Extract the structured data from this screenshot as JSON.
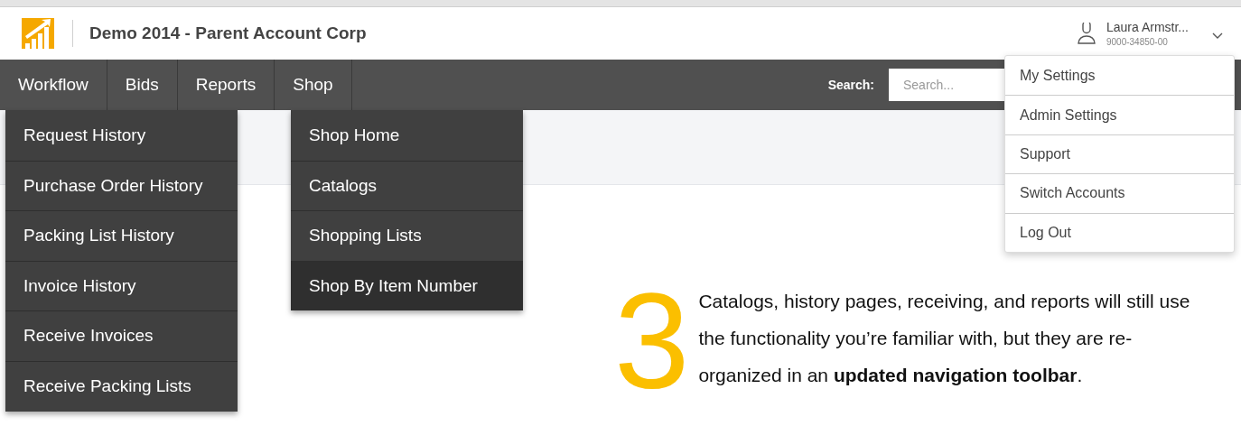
{
  "header": {
    "title": "Demo 2014 - Parent Account Corp",
    "user": {
      "name": "Laura Armstr...",
      "account": "9000-34850-00"
    }
  },
  "nav": {
    "items": [
      {
        "label": "Workflow"
      },
      {
        "label": "Bids"
      },
      {
        "label": "Reports"
      },
      {
        "label": "Shop"
      }
    ],
    "search": {
      "label": "Search:",
      "placeholder": "Search..."
    }
  },
  "workflow_menu": [
    {
      "label": "Request History",
      "highlighted": false
    },
    {
      "label": "Purchase Order History",
      "highlighted": false
    },
    {
      "label": "Packing List History",
      "highlighted": false
    },
    {
      "label": "Invoice History",
      "highlighted": false
    },
    {
      "label": "Receive Invoices",
      "highlighted": false
    },
    {
      "label": "Receive Packing Lists",
      "highlighted": false
    }
  ],
  "shop_menu": [
    {
      "label": "Shop Home",
      "highlighted": false
    },
    {
      "label": "Catalogs",
      "highlighted": false
    },
    {
      "label": "Shopping Lists",
      "highlighted": false
    },
    {
      "label": "Shop By Item Number",
      "highlighted": true
    }
  ],
  "user_menu": [
    "My Settings",
    "Admin Settings",
    "Support",
    "Switch Accounts",
    "Log Out"
  ],
  "callout": {
    "number": "3",
    "text": "Catalogs, history pages, receiving, and reports will still use the functionality you’re familiar with, but they are re-organized in an **updated navigation toolbar**."
  }
}
